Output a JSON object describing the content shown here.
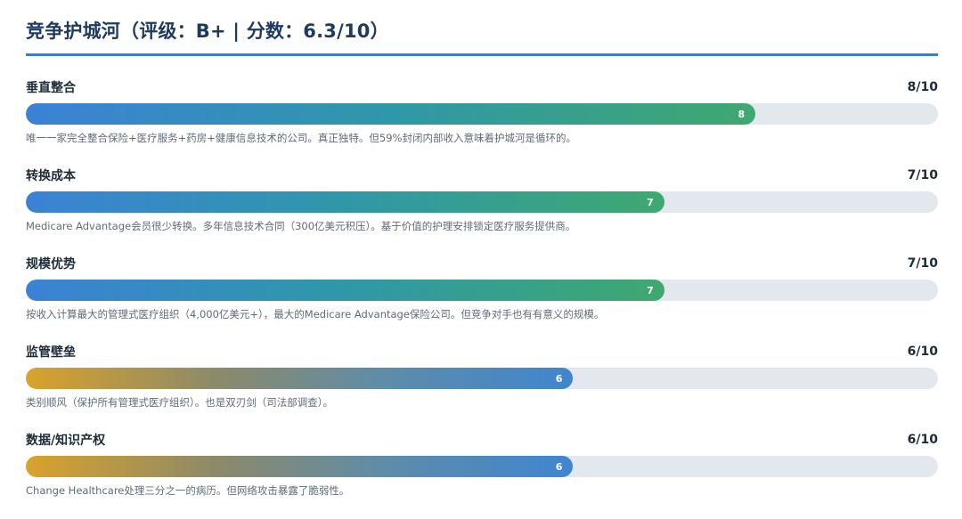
{
  "title": "竞争护城河（评级：B+ | 分数：6.3/10）",
  "items": [
    {
      "label": "垂直整合",
      "score_text": "8/10",
      "value_text": "8",
      "fraction": 0.8,
      "style": "blue-green",
      "description": "唯一一家完全整合保险+医疗服务+药房+健康信息技术的公司。真正独特。但59%封闭内部收入意味着护城河是循环的。"
    },
    {
      "label": "转换成本",
      "score_text": "7/10",
      "value_text": "7",
      "fraction": 0.7,
      "style": "blue-green",
      "description": "Medicare Advantage会员很少转换。多年信息技术合同（300亿美元积压）。基于价值的护理安排锁定医疗服务提供商。"
    },
    {
      "label": "规模优势",
      "score_text": "7/10",
      "value_text": "7",
      "fraction": 0.7,
      "style": "blue-green",
      "description": "按收入计算最大的管理式医疗组织（4,000亿美元+），最大的Medicare Advantage保险公司。但竞争对手也有有意义的规模。"
    },
    {
      "label": "监管壁垒",
      "score_text": "6/10",
      "value_text": "6",
      "fraction": 0.6,
      "style": "gold-blue",
      "description": "类别顺风（保护所有管理式医疗组织）。也是双刃剑（司法部调查）。"
    },
    {
      "label": "数据/知识产权",
      "score_text": "6/10",
      "value_text": "6",
      "fraction": 0.6,
      "style": "gold-blue",
      "description": "Change Healthcare处理三分之一的病历。但网络攻击暴露了脆弱性。"
    }
  ],
  "colors": {
    "title": "#1e3a5f",
    "rule": "#3f7cc4",
    "track": "#e3e8ef",
    "gradient_blue": "#3b82d6",
    "gradient_green": "#3fa870",
    "gradient_gold": "#d9a22c"
  }
}
